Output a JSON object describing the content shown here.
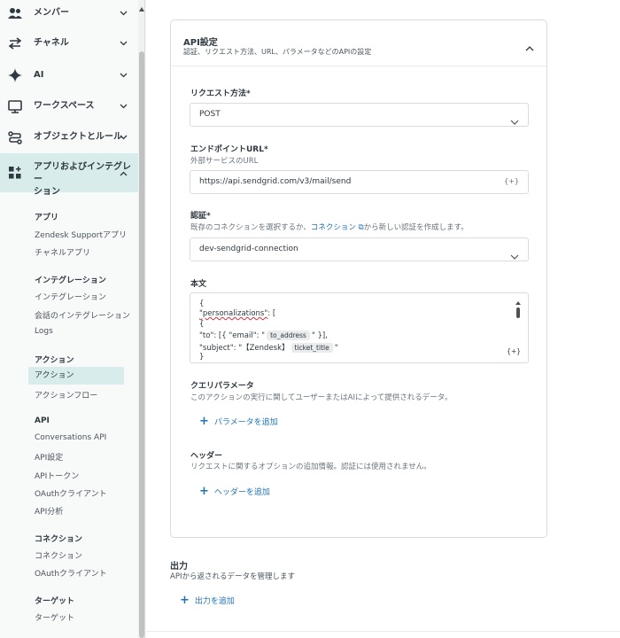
{
  "sidebar": {
    "nav": [
      {
        "label": "メンバー",
        "icon": "people-icon"
      },
      {
        "label": "チャネル",
        "icon": "arrows-swap-icon"
      },
      {
        "label": "AI",
        "icon": "sparkle-icon"
      },
      {
        "label": "ワークスペース",
        "icon": "monitor-icon"
      },
      {
        "label": "オブジェクトとルール",
        "icon": "objects-rules-icon"
      },
      {
        "label1": "アプリおよびインテグレー",
        "label2": "ション",
        "icon": "apps-grid-plus-icon"
      }
    ],
    "sections": {
      "apps": {
        "heading": "アプリ",
        "items": [
          "Zendesk Supportアプリ",
          "チャネルアプリ"
        ]
      },
      "integrations": {
        "heading": "インテグレーション",
        "items": [
          "インテグレーション",
          "会話のインテグレーション",
          "Logs"
        ]
      },
      "actions": {
        "heading": "アクション",
        "items": [
          "アクション",
          "アクションフロー"
        ]
      },
      "api": {
        "heading": "API",
        "items": [
          "Conversations API",
          "API設定",
          "APIトークン",
          "OAuthクライアント",
          "API分析"
        ]
      },
      "connections": {
        "heading": "コネクション",
        "items": [
          "コネクション",
          "OAuthクライアント"
        ]
      },
      "targets": {
        "heading": "ターゲット",
        "items": [
          "ターゲット"
        ]
      }
    }
  },
  "card": {
    "title": "API設定",
    "subtitle": "認証、リクエスト方法、URL、パラメータなどのAPIの設定",
    "method": {
      "label": "リクエスト方法*",
      "value": "POST"
    },
    "endpoint": {
      "label": "エンドポイントURL*",
      "hint": "外部サービスのURL",
      "value": "https://api.sendgrid.com/v3/mail/send",
      "var_button": "{+}"
    },
    "auth": {
      "label": "認証*",
      "hint_before": "既存のコネクションを選択するか、",
      "hint_link": "コネクション ⧉",
      "hint_after": "から新しい認証を作成します。",
      "value": "dev-sendgrid-connection"
    },
    "body": {
      "label": "本文",
      "line1": "{",
      "line2_key": "\"personalizations\"",
      "line2_rest": ": [",
      "line3": "{",
      "line4_a": "\"to\": [{ \"email\": \"",
      "line4_pill": "to_address",
      "line4_b": "\" }],",
      "line5_a": "\"subject\": \"【Zendesk】",
      "line5_pill": "ticket_title",
      "line5_b": "\"",
      "line6": "}",
      "var_button": "{+}"
    },
    "query": {
      "label": "クエリパラメータ",
      "hint": "このアクションの実行に関してユーザーまたはAIによって提供されるデータ。",
      "add": "パラメータを追加"
    },
    "headers": {
      "label": "ヘッダー",
      "hint": "リクエストに関するオプションの追加情報。認証には使用されません。",
      "add": "ヘッダーを追加"
    }
  },
  "output": {
    "title": "出力",
    "subtitle": "APIから返されるデータを管理します",
    "add": "出力を追加"
  }
}
